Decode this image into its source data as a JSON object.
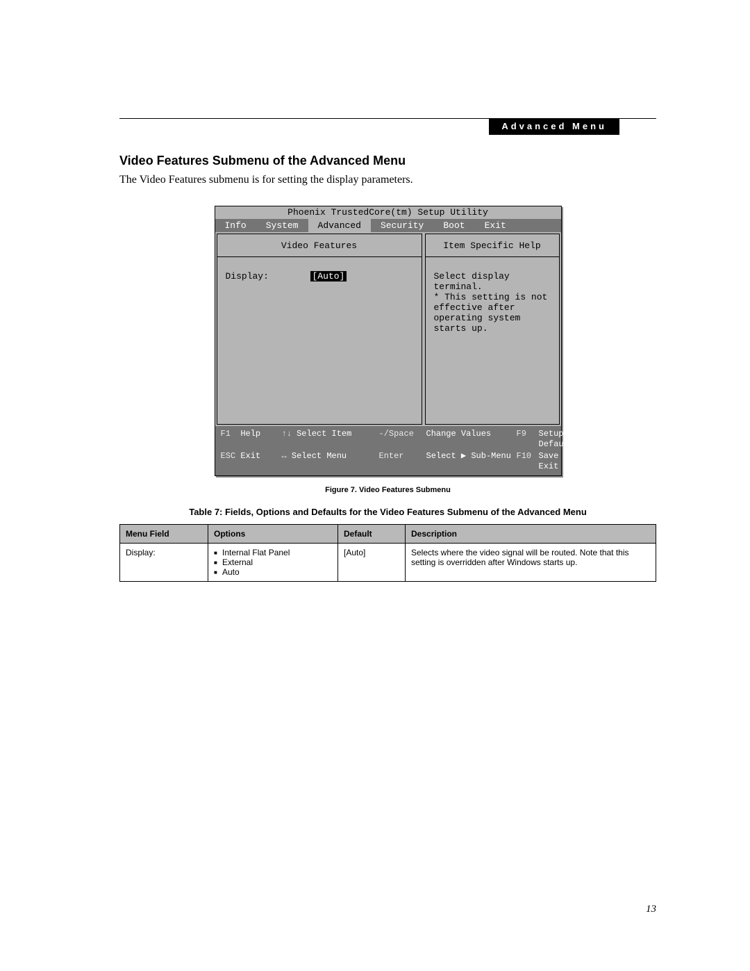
{
  "header": {
    "badge": "Advanced Menu"
  },
  "section": {
    "title": "Video Features Submenu of the Advanced Menu",
    "intro": "The Video Features submenu is for setting the display parameters."
  },
  "bios": {
    "title": "Phoenix TrustedCore(tm) Setup Utility",
    "tabs": [
      "Info",
      "System",
      "Advanced",
      "Security",
      "Boot",
      "Exit"
    ],
    "active_tab_index": 2,
    "left_panel_title": "Video Features",
    "right_panel_title": "Item Specific Help",
    "setting_label": "Display:",
    "setting_value": "[Auto]",
    "help_lines": [
      "Select display terminal.",
      "",
      "* This setting is not",
      "effective after",
      "operating system",
      "starts up."
    ],
    "footer": {
      "f1": "F1",
      "f1_label": "Help",
      "arrows_v": "↑↓",
      "arrows_v_label": "Select Item",
      "minus_space": "-/Space",
      "minus_space_label": "Change Values",
      "f9": "F9",
      "f9_label": "Setup Defaults",
      "esc": "ESC",
      "esc_label": "Exit",
      "arrows_h": "↔",
      "arrows_h_label": "Select Menu",
      "enter": "Enter",
      "enter_label": "Select ▶ Sub-Menu",
      "f10": "F10",
      "f10_label": "Save and Exit"
    }
  },
  "figure_caption": "Figure 7.  Video Features Submenu",
  "table_caption": "Table 7: Fields, Options and Defaults for the Video Features Submenu of the Advanced Menu",
  "table": {
    "headers": [
      "Menu Field",
      "Options",
      "Default",
      "Description"
    ],
    "row": {
      "menu_field": "Display:",
      "options": [
        "Internal Flat Panel",
        "External",
        "Auto"
      ],
      "default": "[Auto]",
      "description": "Selects where the video signal will be routed. Note that this setting is overridden after Windows starts up."
    }
  },
  "page_number": "13"
}
